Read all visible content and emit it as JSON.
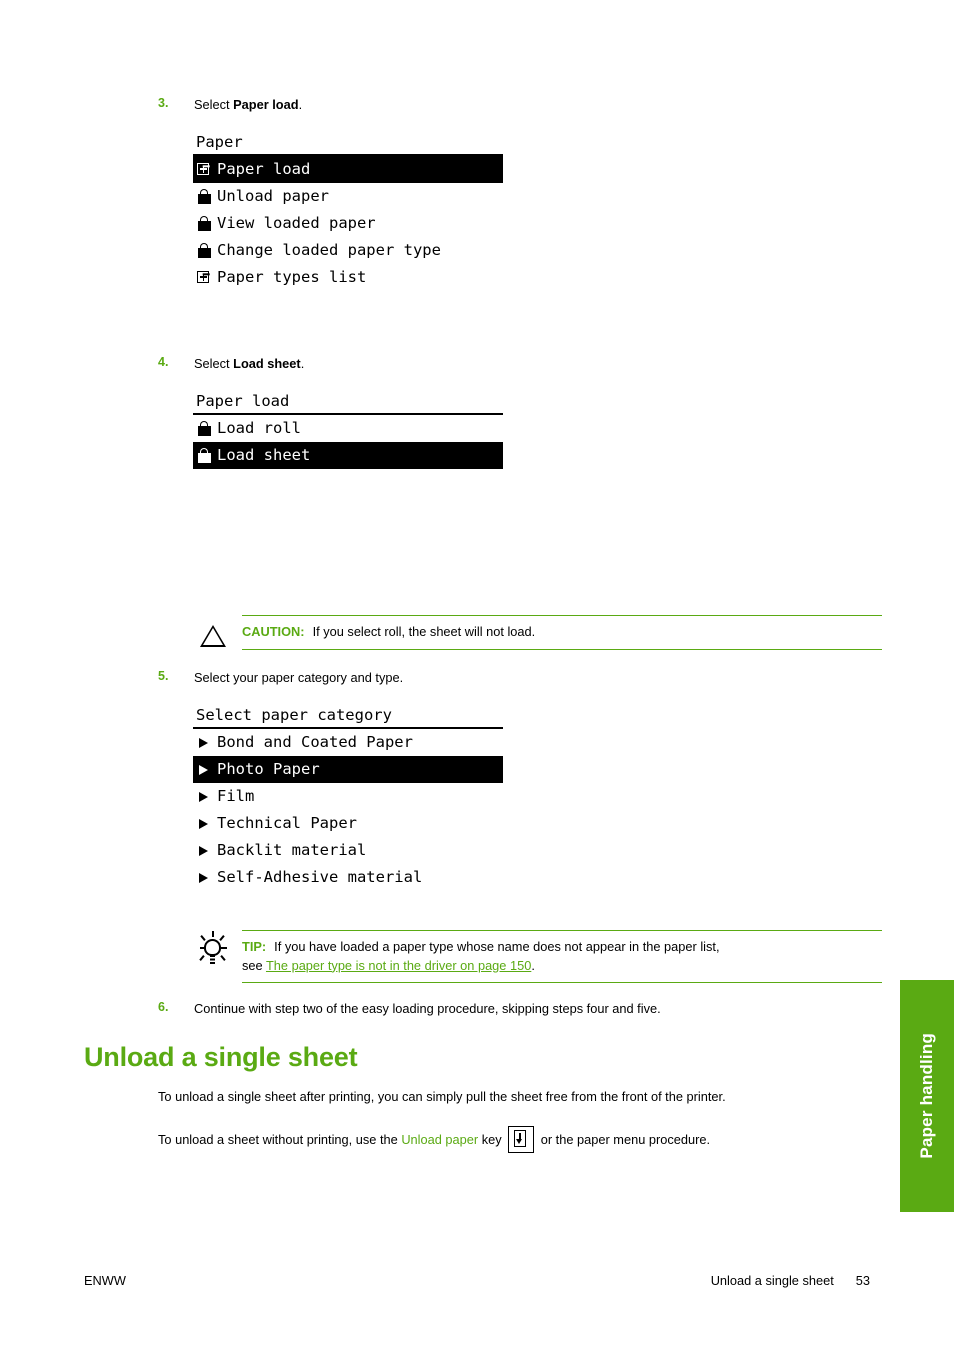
{
  "steps": [
    {
      "num": "3.",
      "text_before": "Select ",
      "bold": "Paper load",
      "text_after": "."
    },
    {
      "num": "4.",
      "text_before": "Select ",
      "bold": "Load sheet",
      "text_after": "."
    },
    {
      "num": "5.",
      "text_before": "Select your paper category and type.",
      "bold": "",
      "text_after": ""
    },
    {
      "num": "6.",
      "text_before": "Continue with step two of the easy loading procedure, skipping steps four and five.",
      "bold": "",
      "text_after": ""
    }
  ],
  "menus": [
    {
      "title": "Paper",
      "rows": [
        {
          "icon": "plus-box-icon",
          "label": "Paper load",
          "selected": true
        },
        {
          "icon": "padlock-icon",
          "label": "Unload paper",
          "selected": false
        },
        {
          "icon": "padlock-icon",
          "label": "View loaded paper",
          "selected": false
        },
        {
          "icon": "padlock-icon",
          "label": "Change loaded paper type",
          "selected": false
        },
        {
          "icon": "plus-box-icon",
          "label": "Paper types list",
          "selected": false
        }
      ]
    },
    {
      "title": "Paper load",
      "rows": [
        {
          "icon": "padlock-icon",
          "label": "Load roll",
          "selected": false
        },
        {
          "icon": "padlock-icon",
          "label": "Load sheet",
          "selected": true
        }
      ]
    },
    {
      "title": "Select paper category",
      "rows": [
        {
          "icon": "triangle-right-icon",
          "label": "Bond and Coated Paper",
          "selected": false
        },
        {
          "icon": "triangle-right-icon",
          "label": "Photo Paper",
          "selected": true
        },
        {
          "icon": "triangle-right-icon",
          "label": "Film",
          "selected": false
        },
        {
          "icon": "triangle-right-icon",
          "label": "Technical Paper",
          "selected": false
        },
        {
          "icon": "triangle-right-icon",
          "label": "Backlit material",
          "selected": false
        },
        {
          "icon": "triangle-right-icon",
          "label": "Self-Adhesive material",
          "selected": false
        }
      ]
    }
  ],
  "caution": {
    "icon": "warning-triangle-icon",
    "keyword": "CAUTION:",
    "text": "If you select roll, the sheet will not load."
  },
  "tip": {
    "icon": "lightbulb-icon",
    "keyword": "TIP:",
    "text_line1": "If you have loaded a paper type whose name does not appear in the paper list,",
    "text_see": "see ",
    "link": "The paper type is not in the driver on page 150",
    "text_end": "."
  },
  "heading": "Unload a single sheet",
  "paragraphs": {
    "p1": "To unload a single sheet after printing, you can simply pull the sheet free from the front of the printer.",
    "p2_before": "To unload a sheet without printing, use the ",
    "p2_green": "Unload paper",
    "p2_mid": " key ",
    "p2_after": " or the paper menu procedure."
  },
  "side_tab": {
    "label": "Paper handling"
  },
  "footer": {
    "left": "ENWW",
    "section": "Unload a single sheet",
    "page": "53"
  },
  "colors": {
    "accent_green": "#5aaa13",
    "lcd_fg": "#000000",
    "lcd_selected_bg": "#000000"
  }
}
